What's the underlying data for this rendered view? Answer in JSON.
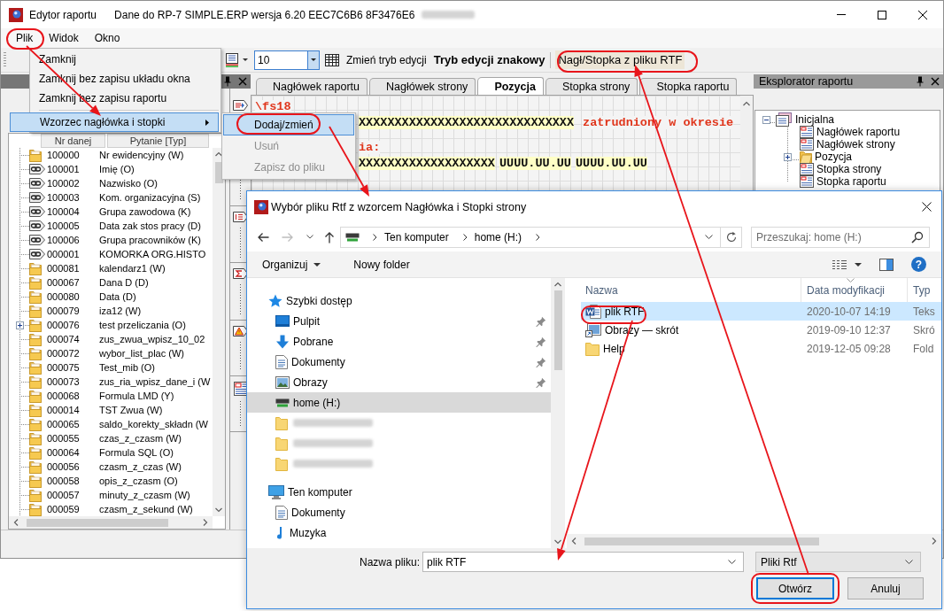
{
  "window": {
    "title": "Edytor raportu",
    "subtitle": "Dane do RP-7 SIMPLE.ERP wersja 6.20 EEC7C6B6 8F3476E6"
  },
  "menu_bar": [
    "Plik",
    "Widok",
    "Okno"
  ],
  "file_menu": [
    {
      "kind": "item",
      "label": "Zamknij",
      "selected": false
    },
    {
      "kind": "item",
      "label": "Zamknij bez zapisu układu okna",
      "selected": false
    },
    {
      "kind": "item",
      "label": "Zamknij bez zapisu raportu",
      "selected": false
    },
    {
      "kind": "separator"
    },
    {
      "kind": "submenu",
      "label": "Wzorzec nagłówka i stopki",
      "selected": true
    }
  ],
  "submenu": [
    {
      "label": "Dodaj/zmień",
      "selected": true,
      "disabled": false
    },
    {
      "label": "Usuń",
      "selected": false,
      "disabled": true
    },
    {
      "label": "Zapisz do pliku",
      "selected": false,
      "disabled": true
    }
  ],
  "toolbar": {
    "font_size": "10",
    "edit_mode_button": "Zmień tryb edycji",
    "edit_mode": "Tryb edycji znakowy",
    "rtf_button": "Nagł/Stopka z pliku RTF"
  },
  "fields_panel": {
    "columns": [
      "Nr danej",
      "Pytanie [Typ]"
    ],
    "rows": [
      {
        "number": "100000",
        "label": "Nr ewidencyjny (W)",
        "kind": "field"
      },
      {
        "number": "100001",
        "label": "Imię (O)",
        "kind": "linked"
      },
      {
        "number": "100002",
        "label": "Nazwisko (O)",
        "kind": "linked"
      },
      {
        "number": "100003",
        "label": "Kom. organizacyjna (S)",
        "kind": "linked"
      },
      {
        "number": "100004",
        "label": "Grupa zawodowa (K)",
        "kind": "linked"
      },
      {
        "number": "100005",
        "label": "Data zak stos pracy (D)",
        "kind": "linked"
      },
      {
        "number": "100006",
        "label": "Grupa pracowników (K)",
        "kind": "linked"
      },
      {
        "number": "000001",
        "label": "KOMORKA ORG.HISTO",
        "kind": "linked"
      },
      {
        "number": "000081",
        "label": "kalendarz1 (W)",
        "kind": "field"
      },
      {
        "number": "000067",
        "label": "Dana D (D)",
        "kind": "field"
      },
      {
        "number": "000080",
        "label": "Data (D)",
        "kind": "field"
      },
      {
        "number": "000079",
        "label": "iza12 (W)",
        "kind": "field"
      },
      {
        "number": "000076",
        "label": "test przeliczania (O)",
        "kind": "field",
        "expanded": false
      },
      {
        "number": "000074",
        "label": "zus_zwua_wpisz_10_02",
        "kind": "field"
      },
      {
        "number": "000072",
        "label": "wybor_list_plac (W)",
        "kind": "field"
      },
      {
        "number": "000075",
        "label": "Test_mib (O)",
        "kind": "field"
      },
      {
        "number": "000073",
        "label": "zus_ria_wpisz_dane_i (W",
        "kind": "field"
      },
      {
        "number": "000068",
        "label": "Formula LMD (Y)",
        "kind": "field"
      },
      {
        "number": "000014",
        "label": "TST Zwua (W)",
        "kind": "field"
      },
      {
        "number": "000065",
        "label": "saldo_korekty_składn (W",
        "kind": "field"
      },
      {
        "number": "000055",
        "label": "czas_z_czasm (W)",
        "kind": "field"
      },
      {
        "number": "000064",
        "label": "Formula SQL (O)",
        "kind": "field"
      },
      {
        "number": "000056",
        "label": "czasm_z_czas (W)",
        "kind": "field"
      },
      {
        "number": "000058",
        "label": "opis_z_czasm (O)",
        "kind": "field"
      },
      {
        "number": "000057",
        "label": "minuty_z_czasm (W)",
        "kind": "field"
      },
      {
        "number": "000059",
        "label": "czasm_z_sekund (W)",
        "kind": "field"
      }
    ]
  },
  "editor": {
    "tabs": [
      {
        "label": "Nagłówek raportu",
        "selected": false
      },
      {
        "label": "Nagłówek strony",
        "selected": false
      },
      {
        "label": "Pozycja",
        "selected": true
      },
      {
        "label": "Stopka strony",
        "selected": false
      },
      {
        "label": "Stopka raportu",
        "selected": false
      }
    ],
    "lines": [
      {
        "segments": [
          {
            "kind": "code",
            "text": "\\fs18"
          }
        ]
      },
      {
        "segments": [
          {
            "kind": "mask",
            "text": "XXXXXXXXXXXXXXXXXXXXXXXXXXXXXX"
          },
          {
            "kind": "code",
            "text": "zatrudniony w okresie"
          }
        ]
      },
      {
        "segments": [
          {
            "kind": "code",
            "text": "ia:"
          }
        ]
      },
      {
        "segments": [
          {
            "kind": "mask",
            "text": "XXXXXXXXXXXXXXXXXXX"
          },
          {
            "kind": "mask",
            "text": "UUUU.UU.UU"
          },
          {
            "kind": "mask",
            "text": "UUUU.UU.UU"
          }
        ]
      }
    ]
  },
  "explorer": {
    "title": "Eksplorator raportu",
    "tree": [
      {
        "label": "Inicjalna",
        "kind": "report",
        "expanded": true,
        "children": [
          {
            "label": "Nagłówek raportu",
            "kind": "band"
          },
          {
            "label": "Nagłówek strony",
            "kind": "band"
          },
          {
            "label": "Pozycja",
            "kind": "folder",
            "expanded": false
          },
          {
            "label": "Stopka strony",
            "kind": "band"
          },
          {
            "label": "Stopka raportu",
            "kind": "band"
          }
        ]
      }
    ]
  },
  "dialog": {
    "title": "Wybór pliku Rtf z wzorcem Nagłówka i Stopki strony",
    "path": [
      "Ten komputer",
      "home (H:)"
    ],
    "search": {
      "placeholder": "Przeszukaj: home (H:)"
    },
    "commands": [
      {
        "label": "Organizuj",
        "kind": "menu"
      },
      {
        "label": "Nowy folder",
        "kind": "button"
      }
    ],
    "help": "?",
    "nav": [
      {
        "label": "Szybki dostęp",
        "kind": "star",
        "selected": false,
        "children": [
          {
            "label": "Pulpit",
            "kind": "desktop",
            "pinned": true,
            "selected": false
          },
          {
            "label": "Pobrane",
            "kind": "downloads",
            "pinned": true,
            "selected": false
          },
          {
            "label": "Dokumenty",
            "kind": "documents",
            "pinned": true,
            "selected": false
          },
          {
            "label": "Obrazy",
            "kind": "pictures",
            "pinned": true,
            "selected": false
          },
          {
            "label": "home (H:)",
            "kind": "drive",
            "pinned": false,
            "selected": true
          },
          {
            "kind": "folder",
            "pinned": false,
            "selected": false
          },
          {
            "kind": "folder",
            "pinned": false,
            "selected": false
          },
          {
            "kind": "folder",
            "pinned": false,
            "selected": false
          }
        ]
      },
      {
        "label": "Ten komputer",
        "kind": "computer",
        "selected": false,
        "children": [
          {
            "label": "Dokumenty",
            "kind": "documents",
            "pinned": false,
            "selected": false
          },
          {
            "label": "Muzyka",
            "kind": "music",
            "pinned": false,
            "selected": false
          }
        ]
      }
    ],
    "files": {
      "columns": [
        "Nazwa",
        "Data modyfikacji",
        "Typ"
      ],
      "rows": [
        {
          "name": "plik RTF",
          "date": "2020-10-07 14:19",
          "type": "Teks",
          "kind": "document",
          "selected": true
        },
        {
          "name": "Obrazy — skrót",
          "date": "2019-09-10 12:37",
          "type": "Skró",
          "kind": "shortcut",
          "selected": false
        },
        {
          "name": "Help",
          "date": "2019-12-05 09:28",
          "type": "Fold",
          "kind": "folder",
          "selected": false
        }
      ]
    },
    "filename_label": "Nazwa pliku:",
    "filename": "plik RTF",
    "filter": "Pliki Rtf",
    "buttons": [
      {
        "label": "Otwórz",
        "default": true
      },
      {
        "label": "Anuluj",
        "default": false
      }
    ]
  }
}
